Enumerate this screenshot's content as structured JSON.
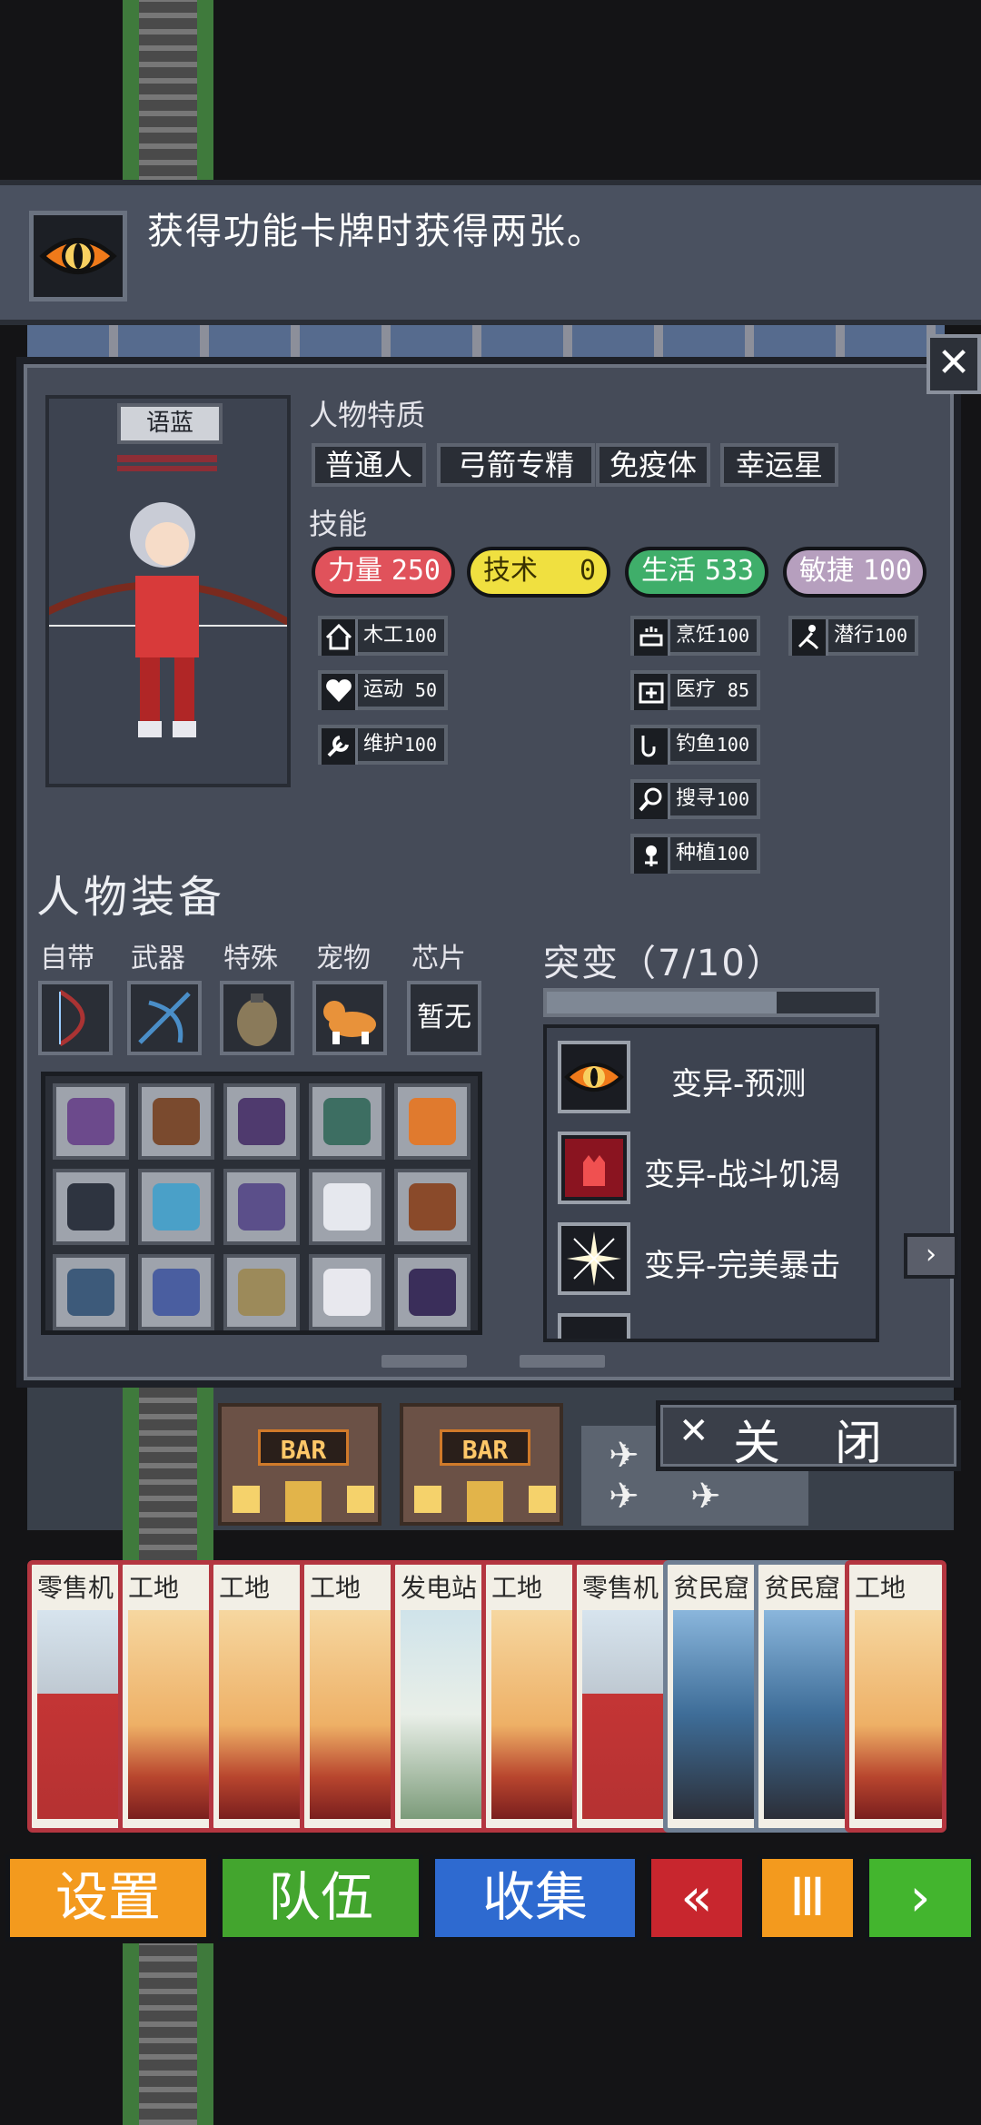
{
  "tooltip": {
    "text": "获得功能卡牌时获得两张。",
    "icon": "eye-icon"
  },
  "character": {
    "name": "语蓝",
    "traits_label": "人物特质",
    "traits": [
      "普通人",
      "弓箭专精",
      "免疫体",
      "幸运星"
    ],
    "skills_label": "技能",
    "stats": [
      {
        "label": "力量",
        "value": "250",
        "color": "#e0525b"
      },
      {
        "label": "技术",
        "value": "0",
        "color": "#f0e040"
      },
      {
        "label": "生活",
        "value": "533",
        "color": "#3fae6a"
      },
      {
        "label": "敏捷",
        "value": "100",
        "color": "#b69fbe"
      }
    ],
    "skills": [
      {
        "label": "木工",
        "value": "100",
        "icon": "house-icon"
      },
      {
        "label": "运动",
        "value": "50",
        "icon": "heart-icon"
      },
      {
        "label": "维护",
        "value": "100",
        "icon": "wrench-icon"
      },
      {
        "label": "烹饪",
        "value": "100",
        "icon": "cooking-pot-icon"
      },
      {
        "label": "医疗",
        "value": "85",
        "icon": "medkit-icon"
      },
      {
        "label": "钓鱼",
        "value": "100",
        "icon": "fishing-icon"
      },
      {
        "label": "搜寻",
        "value": "100",
        "icon": "magnifier-icon"
      },
      {
        "label": "种植",
        "value": "100",
        "icon": "plant-icon"
      },
      {
        "label": "潜行",
        "value": "100",
        "icon": "sneak-icon"
      }
    ]
  },
  "equipment": {
    "title": "人物装备",
    "slots": [
      {
        "label": "自带",
        "icon": "bow-icon"
      },
      {
        "label": "武器",
        "icon": "crossbow-icon"
      },
      {
        "label": "特殊",
        "icon": "grenade-icon"
      },
      {
        "label": "宠物",
        "icon": "corgi-icon"
      },
      {
        "label": "芯片",
        "value": "暂无"
      }
    ],
    "inventory": [
      {
        "icon": "vest-icon",
        "color": "#6c4a8c"
      },
      {
        "icon": "backpack-icon",
        "color": "#7a4a2e"
      },
      {
        "icon": "hat-icon",
        "color": "#4f3a6e"
      },
      {
        "icon": "armor-icon",
        "color": "#3d6e62"
      },
      {
        "icon": "ring-icon",
        "color": "#e07a2e"
      },
      {
        "icon": "pants-icon",
        "color": "#2e3440"
      },
      {
        "icon": "mask-icon",
        "color": "#4aa0c8"
      },
      {
        "icon": "glasses-icon",
        "color": "#5b4f8a"
      },
      {
        "icon": "shirt-icon",
        "color": "#e6e8ee"
      },
      {
        "icon": "bag-icon",
        "color": "#8a4a2a"
      },
      {
        "icon": "jeans-icon",
        "color": "#3d5a7a"
      },
      {
        "icon": "sweater-icon",
        "color": "#4a5ea0"
      },
      {
        "icon": "boot-icon",
        "color": "#9c8a5a"
      },
      {
        "icon": "sneaker-icon",
        "color": "#e8e8ee"
      },
      {
        "icon": "suit-icon",
        "color": "#3a2e5a"
      }
    ]
  },
  "mutations": {
    "title": "突变（7/10）",
    "progress": 0.7,
    "items": [
      {
        "label": "变异-预测",
        "icon": "eye-icon"
      },
      {
        "label": "变异-战斗饥渴",
        "icon": "fist-icon"
      },
      {
        "label": "变异-完美暴击",
        "icon": "sparkle-icon"
      }
    ]
  },
  "close_label": "关闭",
  "map": {
    "bar_sign": "BAR"
  },
  "cards": [
    {
      "title": "零售机",
      "type": "vend"
    },
    {
      "title": "工地",
      "type": "site"
    },
    {
      "title": "工地",
      "type": "site"
    },
    {
      "title": "工地",
      "type": "site"
    },
    {
      "title": "发电站",
      "type": "power"
    },
    {
      "title": "工地",
      "type": "site"
    },
    {
      "title": "零售机",
      "type": "vend"
    },
    {
      "title": "贫民窟",
      "type": "slum"
    },
    {
      "title": "贫民窟",
      "type": "slum"
    },
    {
      "title": "工地",
      "type": "site"
    }
  ],
  "nav": [
    {
      "label": "设置",
      "color": "#f39a1e"
    },
    {
      "label": "队伍",
      "color": "#43a52e"
    },
    {
      "label": "收集",
      "color": "#2e6ad0"
    },
    {
      "label": "«",
      "color": "#c8262e"
    },
    {
      "label": "Ⅲ",
      "color": "#f39a1e"
    },
    {
      "label": "›",
      "color": "#43b52e"
    }
  ]
}
